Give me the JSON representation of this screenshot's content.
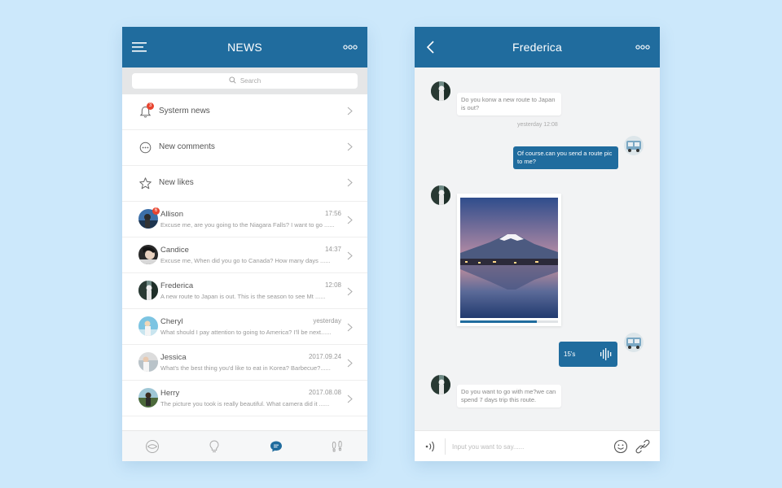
{
  "news": {
    "title": "NEWS",
    "menu_icon": "hamburger-icon",
    "more_icon": "more-dots-icon",
    "search": {
      "placeholder": "Search",
      "icon": "search-icon"
    },
    "system_items": [
      {
        "label": "Systerm news",
        "icon": "bell-icon",
        "badge": "3"
      },
      {
        "label": "New comments",
        "icon": "comment-dots-icon",
        "badge": ""
      },
      {
        "label": "New likes",
        "icon": "star-icon",
        "badge": ""
      }
    ],
    "messages": [
      {
        "name": "Allison",
        "time": "17:56",
        "preview": "Excuse me, are you going to the Niagara Falls? I want to go ......",
        "badge": "6"
      },
      {
        "name": "Candice",
        "time": "14:37",
        "preview": "Excuse me, When did you go to Canada? How many days  ......",
        "badge": ""
      },
      {
        "name": "Frederica",
        "time": "12:08",
        "preview": "A new route to Japan is out. This is the season to see Mt ......",
        "badge": ""
      },
      {
        "name": "Cheryl",
        "time": "yesterday",
        "preview": "What should I pay attention to going to America? I'll be next......",
        "badge": ""
      },
      {
        "name": "Jessica",
        "time": "2017.09.24",
        "preview": "What's the best thing you'd like to eat in Korea? Barbecue?......",
        "badge": ""
      },
      {
        "name": "Herry",
        "time": "2017.08.08",
        "preview": "The picture you took is really beautiful. What camera did it ......",
        "badge": ""
      }
    ],
    "tabs": [
      {
        "name": "discover-eye-icon",
        "active": false
      },
      {
        "name": "lightbulb-icon",
        "active": false
      },
      {
        "name": "chat-bubble-icon",
        "active": true
      },
      {
        "name": "footprint-icon",
        "active": false
      }
    ]
  },
  "chat": {
    "title": "Frederica",
    "back_icon": "back-arrow-icon",
    "more_icon": "more-dots-icon",
    "messages": [
      {
        "from": "them",
        "text": "Do you konw a new route to Japan is out?"
      },
      {
        "from": "me",
        "text": "Of course.can you send a route pic to me?"
      },
      {
        "from": "them",
        "type": "image",
        "alt": "mount-fuji-photo"
      },
      {
        "from": "me",
        "type": "voice",
        "duration": "15's"
      },
      {
        "from": "them",
        "text": "Do you want to go with me?we can spend 7 days trip this route."
      }
    ],
    "timestamp": "yesterday 12:08",
    "input_placeholder": "Input you want to say......"
  },
  "colors": {
    "primary": "#206c9e",
    "background": "#cce8fb",
    "badge": "#e8442f"
  }
}
